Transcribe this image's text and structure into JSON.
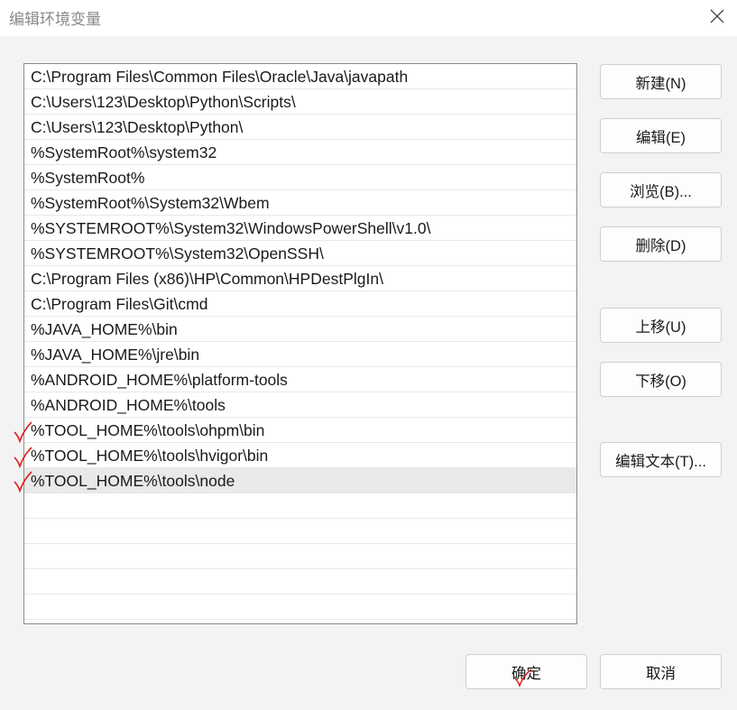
{
  "window": {
    "title": "编辑环境变量",
    "close_icon": "close-icon"
  },
  "paths": [
    "C:\\Program Files\\Common Files\\Oracle\\Java\\javapath",
    "C:\\Users\\123\\Desktop\\Python\\Scripts\\",
    "C:\\Users\\123\\Desktop\\Python\\",
    "%SystemRoot%\\system32",
    "%SystemRoot%",
    "%SystemRoot%\\System32\\Wbem",
    "%SYSTEMROOT%\\System32\\WindowsPowerShell\\v1.0\\",
    "%SYSTEMROOT%\\System32\\OpenSSH\\",
    "C:\\Program Files (x86)\\HP\\Common\\HPDestPlgIn\\",
    "C:\\Program Files\\Git\\cmd",
    "%JAVA_HOME%\\bin",
    "%JAVA_HOME%\\jre\\bin",
    "%ANDROID_HOME%\\platform-tools",
    "%ANDROID_HOME%\\tools",
    "%TOOL_HOME%\\tools\\ohpm\\bin",
    "%TOOL_HOME%\\tools\\hvigor\\bin",
    "%TOOL_HOME%\\tools\\node",
    "",
    "",
    "",
    "",
    "",
    ""
  ],
  "selected_index": 16,
  "buttons": {
    "new": "新建(N)",
    "edit": "编辑(E)",
    "browse": "浏览(B)...",
    "delete": "删除(D)",
    "move_up": "上移(U)",
    "move_down": "下移(O)",
    "edit_text": "编辑文本(T)...",
    "ok": "确定",
    "cancel": "取消"
  },
  "annotation_color": "#e02020"
}
